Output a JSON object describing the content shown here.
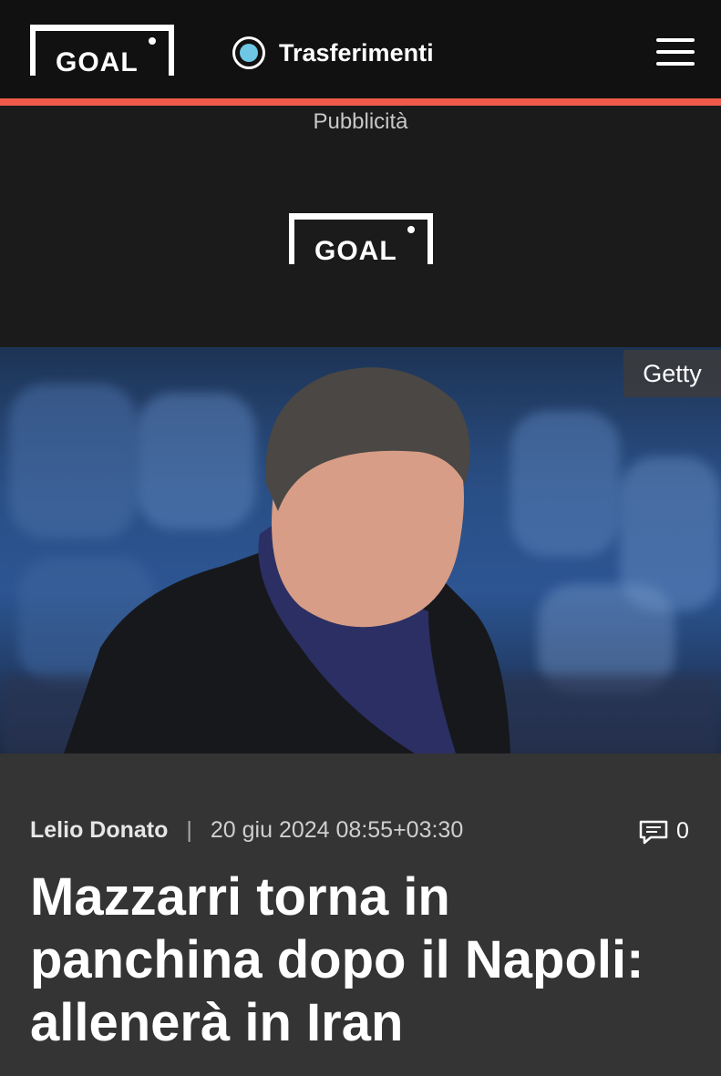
{
  "header": {
    "logo_text": "GOAL",
    "nav_label": "Trasferimenti",
    "nav_icon": "radio-dot-icon",
    "menu_icon": "hamburger-menu-icon",
    "accent_color": "#ef5a4a"
  },
  "ad": {
    "label": "Pubblicità",
    "logo_text": "GOAL"
  },
  "hero": {
    "credit": "Getty"
  },
  "article": {
    "author": "Lelio Donato",
    "separator": "|",
    "date": "20 giu 2024 08:55+03:30",
    "comment_count": "0",
    "comment_icon": "comment-bubble-icon",
    "headline_lines": [
      "Mazzarri torna in",
      "panchina dopo il Napoli:",
      "allenerà in Iran"
    ]
  }
}
